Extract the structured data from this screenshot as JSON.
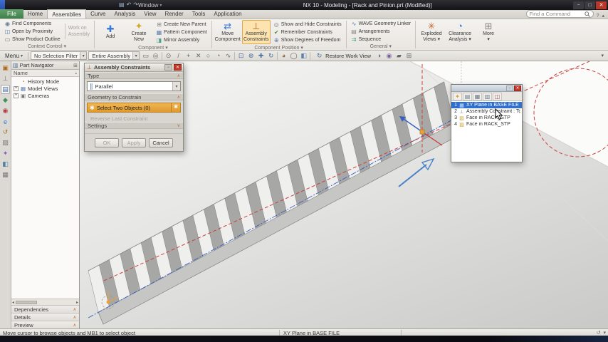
{
  "icons": {
    "chevron_down": "▾",
    "chevron_up": "▴",
    "section_open": "∧",
    "section_closed": "∨",
    "close": "✕",
    "pin": "−",
    "minimize": "−",
    "maximize": "□",
    "window_grid": "⊞",
    "left_arrow": "◂",
    "right_arrow": "▸",
    "help": "?",
    "history": "↺",
    "parallel": "∥",
    "constraint": "⊥",
    "select_star": "✱"
  },
  "titlebar": {
    "title": "NX 10 - Modeling - [Rack and Pinion.prt (Modified)]",
    "window_menu_label": "Window",
    "qat_icons": [
      {
        "name": "save-icon",
        "glyph": "▤",
        "color": "#9fb6d4"
      },
      {
        "name": "undo-icon",
        "glyph": "↶",
        "color": "#9fb6d4"
      },
      {
        "name": "redo-icon",
        "glyph": "↷",
        "color": "#9fb6d4"
      }
    ]
  },
  "tabs": {
    "file_label": "File",
    "items": [
      "Home",
      "Assemblies",
      "Curve",
      "Analysis",
      "View",
      "Render",
      "Tools",
      "Application"
    ],
    "active": "Assemblies",
    "search_placeholder": "Find a Command"
  },
  "ribbon_groups": [
    {
      "label": "Context Control",
      "items": [
        {
          "type": "smallstack",
          "items": [
            {
              "name": "find-components",
              "label": "Find Components",
              "glyph": "◉",
              "color": "#6a7f8f"
            },
            {
              "name": "open-by-proximity",
              "label": "Open by Proximity",
              "glyph": "◫",
              "color": "#5b7fae"
            },
            {
              "name": "show-product-outline",
              "label": "Show Product Outline",
              "glyph": "▭",
              "color": "#777777"
            }
          ]
        },
        {
          "type": "workon",
          "line1": "Work on",
          "line2": "Assembly"
        }
      ]
    },
    {
      "label": "Component",
      "items": [
        {
          "type": "big",
          "name": "add-component",
          "label1": "Add",
          "label2": "",
          "glyph": "✚",
          "color": "#3a7bd5"
        },
        {
          "type": "big",
          "name": "create-new",
          "label1": "Create",
          "label2": "New",
          "glyph": "✦",
          "color": "#d9a62e"
        },
        {
          "type": "smallstack",
          "items": [
            {
              "name": "create-new-parent",
              "label": "Create New Parent",
              "glyph": "⊞",
              "color": "#888888"
            },
            {
              "name": "pattern-component",
              "label": "Pattern Component",
              "glyph": "▦",
              "color": "#5b7fae"
            },
            {
              "name": "mirror-assembly",
              "label": "Mirror Assembly",
              "glyph": "◨",
              "color": "#4d9e8a"
            }
          ]
        }
      ]
    },
    {
      "label": "Component Position",
      "items": [
        {
          "type": "big",
          "name": "move-component",
          "label1": "Move",
          "label2": "Component",
          "glyph": "⇄",
          "color": "#3a7bd5"
        },
        {
          "type": "big",
          "name": "assembly-constraints",
          "label1": "Assembly",
          "label2": "Constraints",
          "glyph": "⊥",
          "color": "#b5651d",
          "pressed": true
        },
        {
          "type": "smallstack",
          "items": [
            {
              "name": "show-and-hide-constraints",
              "label": "Show and Hide Constraints",
              "glyph": "◎",
              "color": "#888888"
            },
            {
              "name": "remember-constraints",
              "label": "Remember Constraints",
              "glyph": "✔",
              "color": "#4a8f3f"
            },
            {
              "name": "show-degrees-of-freedom",
              "label": "Show Degrees of Freedom",
              "glyph": "⊕",
              "color": "#5b7fae"
            }
          ]
        }
      ]
    },
    {
      "label": "General",
      "items": [
        {
          "type": "smallstack",
          "items": [
            {
              "name": "wave-geometry-linker",
              "label": "WAVE Geometry Linker",
              "glyph": "∿",
              "color": "#5b7fae"
            },
            {
              "name": "arrangements",
              "label": "Arrangements",
              "glyph": "▤",
              "color": "#888888"
            },
            {
              "name": "sequence",
              "label": "Sequence",
              "glyph": "⇉",
              "color": "#4d9e8a"
            }
          ]
        }
      ]
    },
    {
      "label": "",
      "items": [
        {
          "type": "big",
          "name": "exploded-views",
          "label1": "Exploded",
          "label2": "Views",
          "glyph": "✳",
          "color": "#c2622e",
          "caret": true
        },
        {
          "type": "big",
          "name": "clearance-analysis",
          "label1": "Clearance",
          "label2": "Analysis",
          "glyph": "◔",
          "color": "#3a7bd5",
          "caret": true
        },
        {
          "type": "big",
          "name": "more",
          "label1": "More",
          "label2": "",
          "glyph": "⊞",
          "color": "#888888",
          "caret": true
        }
      ]
    }
  ],
  "toolbar": {
    "menu_label": "Menu",
    "selection_filter": "No Selection Filter",
    "scope_filter": "Entire Assembly",
    "restore_work_view": "Restore Work View",
    "icons": [
      {
        "name": "select-window-icon",
        "glyph": "▭",
        "color": "#666666"
      },
      {
        "name": "highlight-icon",
        "glyph": "◎",
        "color": "#666666"
      },
      {
        "sep": true
      },
      {
        "name": "snap-point-icon",
        "glyph": "⊙",
        "color": "#666666"
      },
      {
        "name": "end-point-icon",
        "glyph": "/",
        "color": "#666666"
      },
      {
        "name": "mid-point-icon",
        "glyph": "+",
        "color": "#666666"
      },
      {
        "name": "intersection-point-icon",
        "glyph": "✕",
        "color": "#666666"
      },
      {
        "name": "arc-center-icon",
        "glyph": "○",
        "color": "#666666"
      },
      {
        "name": "quadrant-point-icon",
        "glyph": "◔",
        "color": "#666666"
      },
      {
        "name": "point-on-curve-icon",
        "glyph": "∿",
        "color": "#666666"
      },
      {
        "sep": true
      },
      {
        "name": "fit-view-icon",
        "glyph": "⊡",
        "color": "#4a6f9f"
      },
      {
        "name": "zoom-icon",
        "glyph": "⊕",
        "color": "#4a6f9f"
      },
      {
        "name": "pan-icon",
        "glyph": "✚",
        "color": "#4a6f9f"
      },
      {
        "name": "rotate-icon",
        "glyph": "↻",
        "color": "#4a6f9f"
      },
      {
        "sep": true
      },
      {
        "name": "shaded-view-icon",
        "glyph": "◕",
        "color": "#8a6f3f"
      },
      {
        "name": "wireframe-view-icon",
        "glyph": "◯",
        "color": "#666666"
      },
      {
        "name": "view-orientation-icon",
        "glyph": "◧",
        "color": "#5b7fae"
      },
      {
        "sep": true
      }
    ],
    "icons_right": [
      {
        "name": "render-style-icon",
        "glyph": "◑",
        "color": "#666666"
      },
      {
        "name": "true-shading-icon",
        "glyph": "◉",
        "color": "#7a5f9f"
      },
      {
        "name": "edit-section-icon",
        "glyph": "▰",
        "color": "#666666"
      },
      {
        "name": "window-icon",
        "glyph": "⊞",
        "color": "#666666"
      }
    ]
  },
  "resource_bar": {
    "icons": [
      {
        "name": "assembly-navigator-icon",
        "glyph": "▣",
        "color": "#b06a1f"
      },
      {
        "name": "constraint-navigator-icon",
        "glyph": "⊥",
        "color": "#777777"
      },
      {
        "name": "part-navigator-icon",
        "glyph": "▤",
        "color": "#3f6fae",
        "active": true
      },
      {
        "name": "reuse-library-icon",
        "glyph": "◆",
        "color": "#3f8f5f"
      },
      {
        "name": "hd3d-tools-icon",
        "glyph": "◉",
        "color": "#b03a3a"
      },
      {
        "name": "internet-explorer-icon",
        "glyph": "e",
        "color": "#2f7fd0"
      },
      {
        "name": "history-palette-icon",
        "glyph": "↺",
        "color": "#a07820"
      },
      {
        "name": "process-studio-icon",
        "glyph": "▧",
        "color": "#777777"
      },
      {
        "name": "manufacturing-wizard-icon",
        "glyph": "✦",
        "color": "#8f5fb0"
      },
      {
        "name": "roles-icon",
        "glyph": "◧",
        "color": "#4f7f9f"
      },
      {
        "name": "system-materials-icon",
        "glyph": "▦",
        "color": "#777777"
      }
    ]
  },
  "part_navigator": {
    "title": "Part Navigator",
    "name_column": "Name",
    "tree": [
      {
        "name": "history-mode",
        "label": "History Mode",
        "glyph": "◔",
        "color": "#c27d1a",
        "expand": ""
      },
      {
        "name": "model-views",
        "label": "Model Views",
        "glyph": "▦",
        "color": "#5b7fae",
        "expand": "+"
      },
      {
        "name": "cameras",
        "label": "Cameras",
        "glyph": "▣",
        "color": "#777777",
        "expand": "+"
      }
    ],
    "sections": [
      "Dependencies",
      "Details",
      "Preview"
    ]
  },
  "dialog": {
    "title": "Assembly Constraints",
    "type_header": "Type",
    "type_value": "Parallel",
    "geometry_header": "Geometry to Constrain",
    "select_label": "Select Two Objects (0)",
    "reverse_label": "Reverse Last Constraint",
    "settings_header": "Settings",
    "ok": "OK",
    "apply": "Apply",
    "cancel": "Cancel"
  },
  "selection_panel": {
    "toolbar_icons": [
      {
        "name": "select-icon",
        "glyph": "✦",
        "color": "#d99a2b"
      },
      {
        "name": "list-view-icon",
        "glyph": "▤",
        "color": "#667788"
      },
      {
        "name": "detail-view-icon",
        "glyph": "▦",
        "color": "#667788"
      },
      {
        "name": "column-view-icon",
        "glyph": "▥",
        "color": "#667788"
      },
      {
        "name": "settings-icon",
        "glyph": "◫",
        "color": "#a05050"
      }
    ],
    "rows": [
      {
        "num": "1",
        "label": "XY Plane in BASE FILE",
        "selected": true,
        "glyph": "▦",
        "color": "#cfe2f8"
      },
      {
        "num": "2",
        "label": "Assembly Constraint : To...",
        "glyph": "⊥",
        "color": "#888888"
      },
      {
        "num": "3",
        "label": "Face in RACK_STP",
        "glyph": "▨",
        "color": "#c9a23a"
      },
      {
        "num": "4",
        "label": "Face in RACK_STP",
        "glyph": "▨",
        "color": "#c9a23a"
      }
    ]
  },
  "status_bar": {
    "message": "Move cursor to browse objects and MB1 to select object",
    "selection_hint": "XY Plane in BASE FILE"
  }
}
